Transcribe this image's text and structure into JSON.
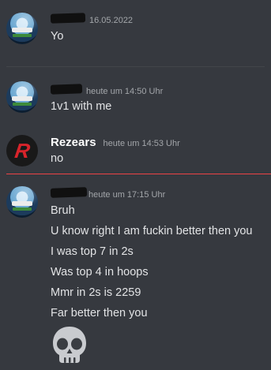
{
  "messages": [
    {
      "time": "16.05.2022",
      "lines": [
        "Yo"
      ]
    },
    {
      "time": "heute um 14:50 Uhr",
      "lines": [
        "1v1 with me"
      ]
    },
    {
      "author": "Rezears",
      "time": "heute um 14:53 Uhr",
      "lines": [
        "no"
      ]
    },
    {
      "time": "heute um 17:15 Uhr",
      "lines": [
        "Bruh",
        "U know right I am fuckin better then you",
        "I was top 7 in 2s",
        "Was top 4 in hoops",
        "Mmr in 2s is 2259",
        "Far better then you"
      ],
      "emoji": "skull-emoji"
    }
  ],
  "avatar_badge": "R",
  "colors": {
    "background": "#36393f",
    "new_messages_divider": "#ed4245",
    "username": "#ffffff",
    "timestamp": "#a3a6aa",
    "text": "#dcddde"
  }
}
